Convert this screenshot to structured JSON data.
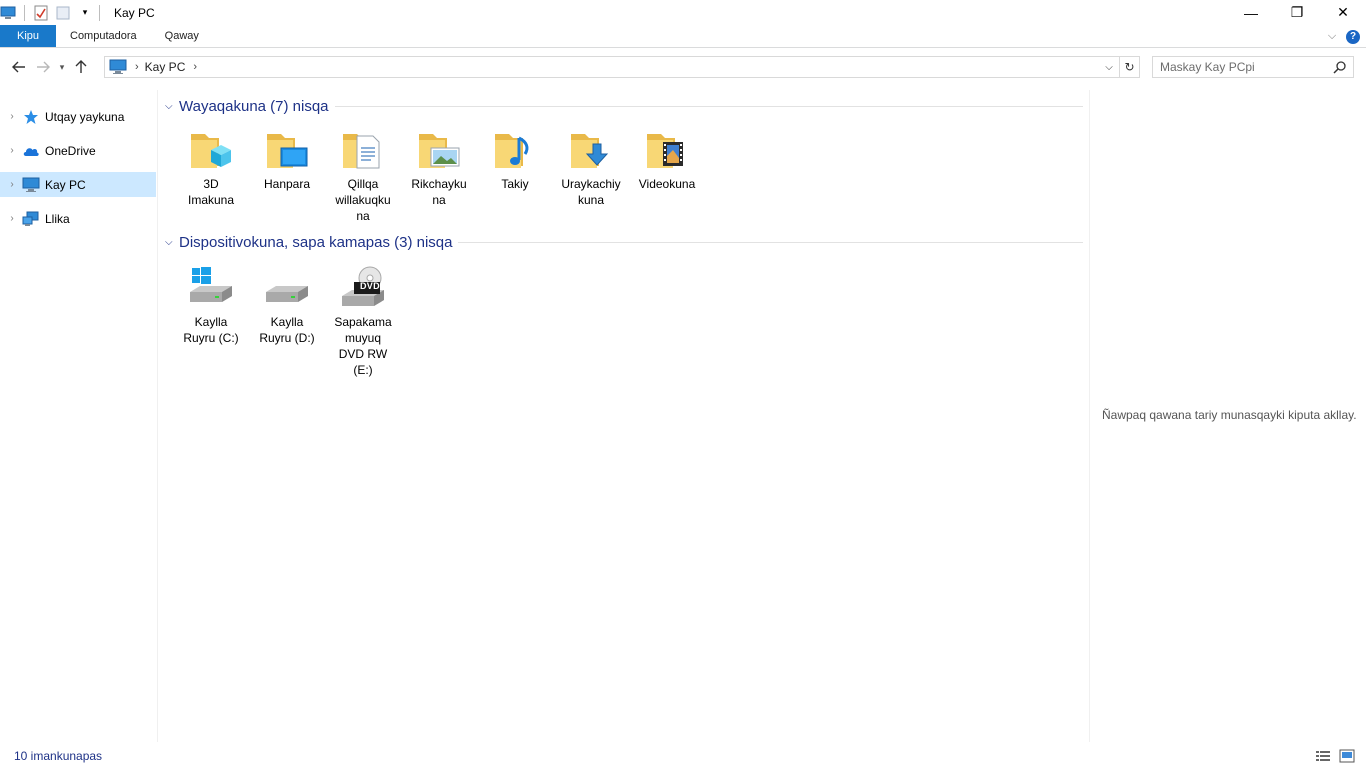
{
  "window": {
    "title": "Kay PC",
    "controls": {
      "minimize": "—",
      "restore": "❐",
      "close": "✕"
    }
  },
  "ribbon": {
    "tabs": [
      {
        "label": "Kipu",
        "active": true
      },
      {
        "label": "Computadora"
      },
      {
        "label": "Qaway"
      }
    ],
    "help_label": "?"
  },
  "address": {
    "breadcrumb": [
      "Kay PC"
    ],
    "search_placeholder": "Maskay Kay PCpi"
  },
  "nav": {
    "items": [
      {
        "label": "Utqay yaykuna",
        "icon": "star-icon"
      },
      {
        "label": "OneDrive",
        "icon": "cloud-icon"
      },
      {
        "label": "Kay PC",
        "icon": "computer-icon",
        "selected": true
      },
      {
        "label": "Llika",
        "icon": "network-icon"
      }
    ]
  },
  "groups": {
    "folders": {
      "title": "Wayaqakuna (7) nisqa",
      "items": [
        {
          "label": "3D Imakuna",
          "icon": "3d-objects-folder-icon"
        },
        {
          "label": "Hanpara",
          "icon": "desktop-folder-icon"
        },
        {
          "label": "Qillqa willakuqkuna",
          "icon": "documents-folder-icon"
        },
        {
          "label": "Rikchaykuna",
          "icon": "pictures-folder-icon"
        },
        {
          "label": "Takiy",
          "icon": "music-folder-icon"
        },
        {
          "label": "Uraykachiykuna",
          "icon": "downloads-folder-icon"
        },
        {
          "label": "Videokuna",
          "icon": "videos-folder-icon"
        }
      ]
    },
    "devices": {
      "title": "Dispositivokuna, sapa kamapas (3) nisqa",
      "items": [
        {
          "label": "Kaylla Ruyru (C:)",
          "icon": "windows-drive-icon"
        },
        {
          "label": "Kaylla Ruyru (D:)",
          "icon": "drive-icon"
        },
        {
          "label": "Sapakama muyuq DVD RW (E:)",
          "icon": "dvd-drive-icon",
          "badge": "DVD"
        }
      ]
    }
  },
  "preview": {
    "message": "Ñawpaq qawana tariy munasqayki kiputa akllay."
  },
  "status": {
    "text": "10 imankunapas"
  },
  "colors": {
    "accent": "#1979ca",
    "group_title": "#1e3287",
    "selection": "#cce8ff",
    "folder": "#f8d775"
  }
}
